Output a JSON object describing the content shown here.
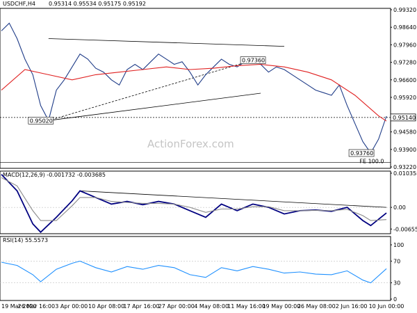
{
  "header": {
    "symbol": "USDCHF,H4",
    "ohlc": "0.95314 0.95534 0.95175 0.95192"
  },
  "watermark": "ActionForex.com",
  "chart_data": [
    {
      "type": "line",
      "title": "USDCHF,H4",
      "role": "price",
      "ylim": [
        0.9322,
        0.9932
      ],
      "yticks": [
        "0.99320",
        "0.98640",
        "0.97960",
        "0.97280",
        "0.96600",
        "0.95920",
        "0.95140",
        "0.94580",
        "0.93900",
        "0.93220"
      ],
      "x_dates": [
        "19 Mar 2020",
        "26 Mar 16:00",
        "3 Apr 00:00",
        "10 Apr 08:00",
        "17 Apr 16:00",
        "27 Apr 00:00",
        "4 May 08:00",
        "11 May 16:00",
        "19 May 00:00",
        "26 May 08:00",
        "2 Jun 16:00",
        "10 Jun 00:00"
      ],
      "series": [
        {
          "name": "close",
          "points": [
            [
              0,
              0.985
            ],
            [
              1,
              0.988
            ],
            [
              2,
              0.982
            ],
            [
              3,
              0.974
            ],
            [
              4,
              0.968
            ],
            [
              5,
              0.956
            ],
            [
              6,
              0.9502
            ],
            [
              7,
              0.962
            ],
            [
              8,
              0.966
            ],
            [
              9,
              0.971
            ],
            [
              10,
              0.976
            ],
            [
              11,
              0.974
            ],
            [
              12,
              0.9705
            ],
            [
              13,
              0.969
            ],
            [
              14,
              0.966
            ],
            [
              15,
              0.964
            ],
            [
              16,
              0.97
            ],
            [
              17,
              0.972
            ],
            [
              18,
              0.97
            ],
            [
              19,
              0.973
            ],
            [
              20,
              0.976
            ],
            [
              21,
              0.974
            ],
            [
              22,
              0.972
            ],
            [
              23,
              0.973
            ],
            [
              24,
              0.969
            ],
            [
              25,
              0.964
            ],
            [
              26,
              0.968
            ],
            [
              27,
              0.971
            ],
            [
              28,
              0.974
            ],
            [
              29,
              0.972
            ],
            [
              30,
              0.971
            ],
            [
              31,
              0.973
            ],
            [
              32,
              0.9736
            ],
            [
              33,
              0.972
            ],
            [
              34,
              0.969
            ],
            [
              35,
              0.971
            ],
            [
              36,
              0.97
            ],
            [
              37,
              0.968
            ],
            [
              38,
              0.966
            ],
            [
              39,
              0.964
            ],
            [
              40,
              0.962
            ],
            [
              41,
              0.961
            ],
            [
              42,
              0.96
            ],
            [
              43,
              0.964
            ],
            [
              44,
              0.956
            ],
            [
              45,
              0.949
            ],
            [
              46,
              0.942
            ],
            [
              47,
              0.9376
            ],
            [
              48,
              0.943
            ],
            [
              49,
              0.9519
            ]
          ]
        },
        {
          "name": "moving average",
          "points": [
            [
              0,
              0.962
            ],
            [
              3,
              0.97
            ],
            [
              6,
              0.968
            ],
            [
              9,
              0.966
            ],
            [
              12,
              0.968
            ],
            [
              15,
              0.969
            ],
            [
              18,
              0.97
            ],
            [
              21,
              0.971
            ],
            [
              24,
              0.97
            ],
            [
              27,
              0.9705
            ],
            [
              30,
              0.9715
            ],
            [
              33,
              0.972
            ],
            [
              36,
              0.971
            ],
            [
              39,
              0.969
            ],
            [
              42,
              0.966
            ],
            [
              45,
              0.96
            ],
            [
              48,
              0.952
            ],
            [
              49,
              0.95
            ]
          ]
        }
      ],
      "annotations": [
        {
          "text": "0.95020",
          "x": 5.2,
          "y": 0.9502
        },
        {
          "text": "0.97360",
          "x": 32.2,
          "y": 0.9736
        },
        {
          "text": "0.93760",
          "x": 46.0,
          "y": 0.9376
        },
        {
          "text": "FE 100.0",
          "x": 47.0,
          "y": 0.9345
        }
      ],
      "current_price": "0.95140",
      "trendlines": [
        {
          "style": "solid",
          "from": [
            6,
            0.9502
          ],
          "to": [
            33,
            0.9608
          ]
        },
        {
          "style": "solid",
          "from": [
            6,
            0.982
          ],
          "to": [
            36,
            0.979
          ]
        },
        {
          "style": "dashed",
          "from": [
            6,
            0.9502
          ],
          "to": [
            32,
            0.9736
          ]
        }
      ],
      "horizontal_lines": [
        {
          "style": "dashed",
          "y": 0.9514
        },
        {
          "style": "solid",
          "y": 0.934
        }
      ]
    },
    {
      "type": "line",
      "title": "MACD(12,26,9) -0.001732 -0.003685",
      "role": "macd",
      "ylim": [
        -0.00755,
        0.01035
      ],
      "yticks": [
        "0.010358",
        "0.00",
        "-0.006553"
      ],
      "series": [
        {
          "name": "main",
          "points": [
            [
              0,
              0.01
            ],
            [
              2,
              0.005
            ],
            [
              4,
              -0.005
            ],
            [
              5,
              -0.0075
            ],
            [
              7,
              -0.003
            ],
            [
              9,
              0.002
            ],
            [
              10,
              0.005
            ],
            [
              12,
              0.003
            ],
            [
              14,
              0.001
            ],
            [
              16,
              0.0018
            ],
            [
              18,
              0.0008
            ],
            [
              20,
              0.0018
            ],
            [
              22,
              0.001
            ],
            [
              24,
              -0.001
            ],
            [
              26,
              -0.003
            ],
            [
              28,
              0.001
            ],
            [
              30,
              -0.001
            ],
            [
              32,
              0.001
            ],
            [
              34,
              0.0
            ],
            [
              36,
              -0.002
            ],
            [
              38,
              -0.001
            ],
            [
              40,
              -0.0008
            ],
            [
              42,
              -0.0012
            ],
            [
              44,
              0.0
            ],
            [
              46,
              -0.004
            ],
            [
              47,
              -0.0055
            ],
            [
              49,
              -0.0017
            ]
          ]
        },
        {
          "name": "signal",
          "points": [
            [
              0,
              0.009
            ],
            [
              2,
              0.0065
            ],
            [
              4,
              -0.001
            ],
            [
              5,
              -0.004
            ],
            [
              7,
              -0.004
            ],
            [
              9,
              0.0005
            ],
            [
              10,
              0.003
            ],
            [
              12,
              0.003
            ],
            [
              14,
              0.0018
            ],
            [
              16,
              0.0015
            ],
            [
              18,
              0.0012
            ],
            [
              20,
              0.0012
            ],
            [
              22,
              0.001
            ],
            [
              24,
              0.0
            ],
            [
              26,
              -0.0015
            ],
            [
              28,
              -0.0005
            ],
            [
              30,
              -0.0005
            ],
            [
              32,
              0.0002
            ],
            [
              34,
              0.0002
            ],
            [
              36,
              -0.001
            ],
            [
              38,
              -0.001
            ],
            [
              40,
              -0.0009
            ],
            [
              42,
              -0.001
            ],
            [
              44,
              -0.0006
            ],
            [
              46,
              -0.0025
            ],
            [
              47,
              -0.004
            ],
            [
              49,
              -0.0037
            ]
          ]
        }
      ],
      "trendlines": [
        {
          "style": "solid",
          "from": [
            10,
            0.005
          ],
          "to": [
            49,
            0.0
          ]
        }
      ]
    },
    {
      "type": "line",
      "title": "RSI(14) 55.5573",
      "role": "rsi",
      "ylim": [
        0,
        100
      ],
      "yticks": [
        "100",
        "70",
        "30",
        "0"
      ],
      "series": [
        {
          "name": "RSI(14)",
          "points": [
            [
              0,
              68
            ],
            [
              2,
              62
            ],
            [
              4,
              45
            ],
            [
              5,
              32
            ],
            [
              7,
              55
            ],
            [
              9,
              66
            ],
            [
              10,
              70
            ],
            [
              12,
              58
            ],
            [
              14,
              50
            ],
            [
              16,
              60
            ],
            [
              18,
              55
            ],
            [
              20,
              62
            ],
            [
              22,
              58
            ],
            [
              24,
              45
            ],
            [
              26,
              40
            ],
            [
              28,
              58
            ],
            [
              30,
              52
            ],
            [
              32,
              60
            ],
            [
              34,
              55
            ],
            [
              36,
              48
            ],
            [
              38,
              50
            ],
            [
              40,
              46
            ],
            [
              42,
              45
            ],
            [
              44,
              52
            ],
            [
              46,
              35
            ],
            [
              47,
              30
            ],
            [
              49,
              56
            ]
          ]
        }
      ]
    }
  ]
}
